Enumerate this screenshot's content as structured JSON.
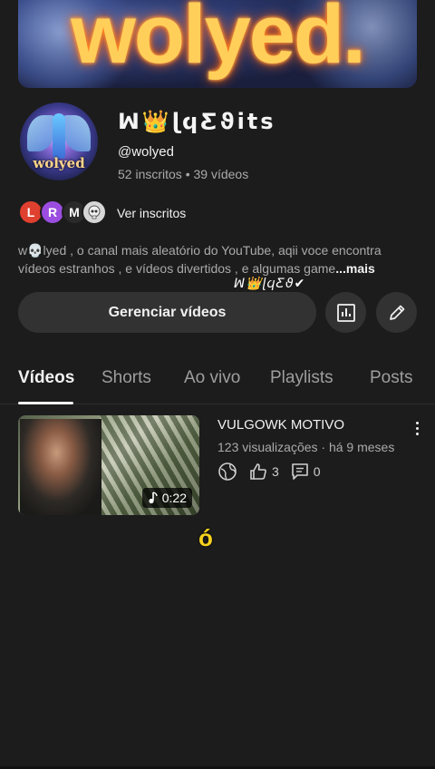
{
  "banner": {
    "logo_text": "wolyed."
  },
  "channel": {
    "avatar_text": "wolyed",
    "name": "ꟽ👑ɭϥƸϑits",
    "handle": "@wolyed",
    "stats": "52 inscritos • 39 vídeos"
  },
  "subscribers": {
    "avatars": [
      "L",
      "R",
      "M",
      ""
    ],
    "label": "Ver inscritos"
  },
  "description": {
    "text": "w💀lyed , o canal mais aleatório do YouTube, aqii voce encontra vídeos estranhos , e vídeos divertidos , e algumas game",
    "more": "...mais",
    "sticker": "ꟽ👑ɭϥƸϑ✔"
  },
  "actions": {
    "manage_label": "Gerenciar vídeos",
    "analytics_icon": "bar-chart-icon",
    "edit_icon": "pencil-icon"
  },
  "tabs": [
    {
      "label": "Vídeos",
      "active": true
    },
    {
      "label": "Shorts"
    },
    {
      "label": "Ao vivo"
    },
    {
      "label": "Playlists"
    },
    {
      "label": "Posts"
    }
  ],
  "videos": [
    {
      "title": "VULGOWK MOTIVO",
      "meta": "123 visualizações · há 9 meses",
      "duration": "0:22",
      "likes": "3",
      "comments": "0"
    }
  ],
  "overlay_char": "ó"
}
